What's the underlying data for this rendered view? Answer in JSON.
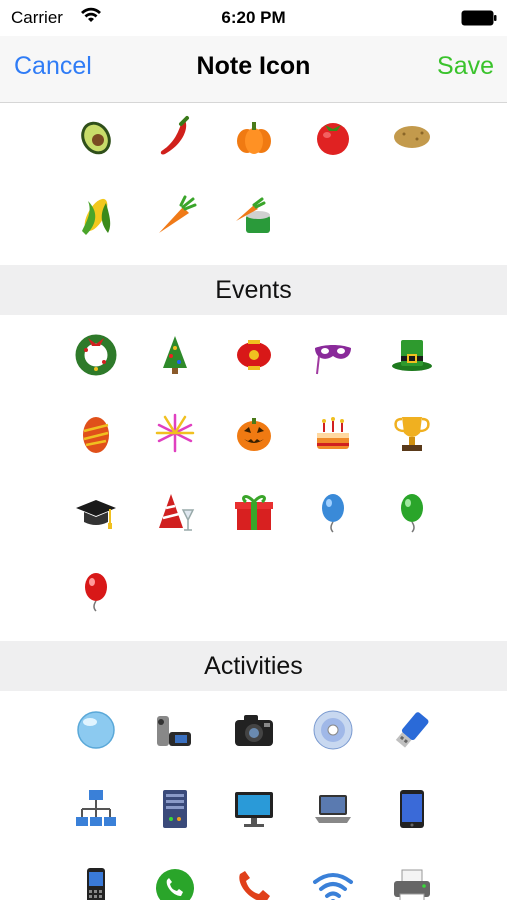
{
  "status_bar": {
    "carrier": "Carrier",
    "time": "6:20 PM"
  },
  "nav": {
    "cancel_label": "Cancel",
    "title": "Note Icon",
    "save_label": "Save"
  },
  "sections": [
    {
      "title": "",
      "icons": [
        "avocado-icon",
        "chili-pepper-icon",
        "pumpkin-icon",
        "tomato-icon",
        "potato-icon",
        "corn-icon",
        "carrot-icon",
        "canned-carrots-icon"
      ]
    },
    {
      "title": "Events",
      "icons": [
        "christmas-wreath-icon",
        "christmas-tree-icon",
        "chinese-lantern-icon",
        "masquerade-mask-icon",
        "leprechaun-hat-icon",
        "easter-egg-icon",
        "fireworks-icon",
        "jack-o-lantern-icon",
        "birthday-cake-icon",
        "trophy-icon",
        "graduation-cap-icon",
        "party-hat-icon",
        "gift-box-icon",
        "blue-balloon-icon",
        "green-balloon-icon",
        "red-balloon-icon"
      ]
    },
    {
      "title": "Activities",
      "icons": [
        "crystal-ball-icon",
        "camcorder-icon",
        "camera-icon",
        "cd-disc-icon",
        "usb-drive-icon",
        "network-icon",
        "server-icon",
        "monitor-icon",
        "laptop-icon",
        "tablet-icon",
        "mobile-phone-icon",
        "green-phone-icon",
        "red-phone-icon",
        "wifi-signal-icon",
        "printer-icon"
      ]
    }
  ]
}
